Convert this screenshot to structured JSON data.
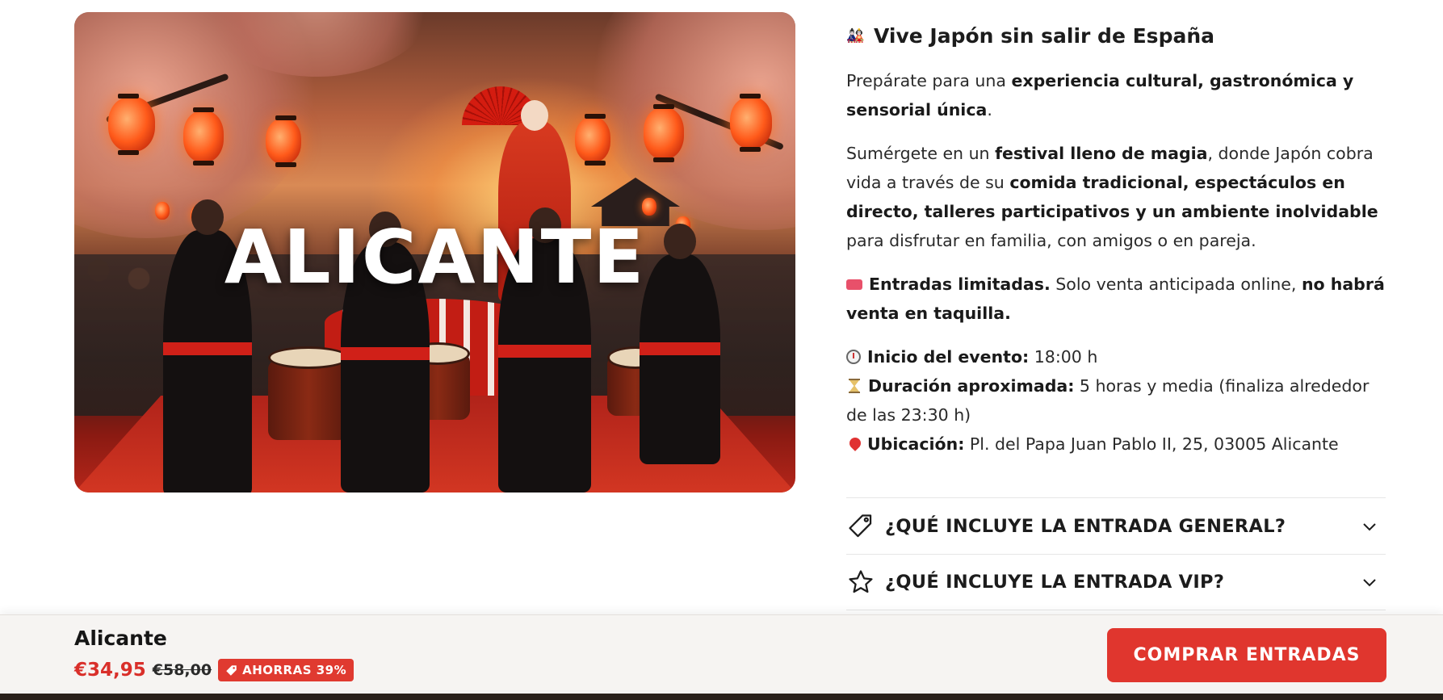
{
  "hero": {
    "overlay_text": "ALICANTE",
    "image_icon": "event-photo-japanese-festival"
  },
  "info": {
    "title_icon": "japanese-dolls-icon",
    "title": "Vive Japón sin salir de España",
    "p1": {
      "t1": "Prepárate para una ",
      "b1": "experiencia cultural, gastronómica y sensorial única",
      "t2": "."
    },
    "p2": {
      "t1": "Sumérgete en un ",
      "b1": "festival lleno de magia",
      "t2": ", donde Japón cobra vida a través de su ",
      "b2": "comida tradicional, espectáculos en directo, talleres participativos y un ambiente inolvidable",
      "t3": " para disfrutar en familia, con amigos o en pareja."
    },
    "p3": {
      "b1": "Entradas limitadas.",
      "t1": " Solo venta anticipada online, ",
      "b2": "no habrá venta en taquilla."
    },
    "details": {
      "start_label": "Inicio del evento:",
      "start_value": " 18:00 h",
      "duration_label": "Duración aproximada:",
      "duration_value": " 5 horas y media (finaliza alrededor de las 23:30 h)",
      "location_label": "Ubicación:",
      "location_value": " Pl. del Papa Juan Pablo II, 25, 03005 Alicante"
    }
  },
  "accordions": {
    "general": "¿QUÉ INCLUYE LA ENTRADA GENERAL?",
    "vip": "¿QUÉ INCLUYE LA ENTRADA VIP?"
  },
  "sticky": {
    "name": "Alicante",
    "price_now": "€34,95",
    "price_old": "€58,00",
    "save_badge": "AHORRAS 39%",
    "buy_label": "COMPRAR ENTRADAS"
  },
  "colors": {
    "accent": "#e0362e",
    "price": "#d92f2a"
  }
}
